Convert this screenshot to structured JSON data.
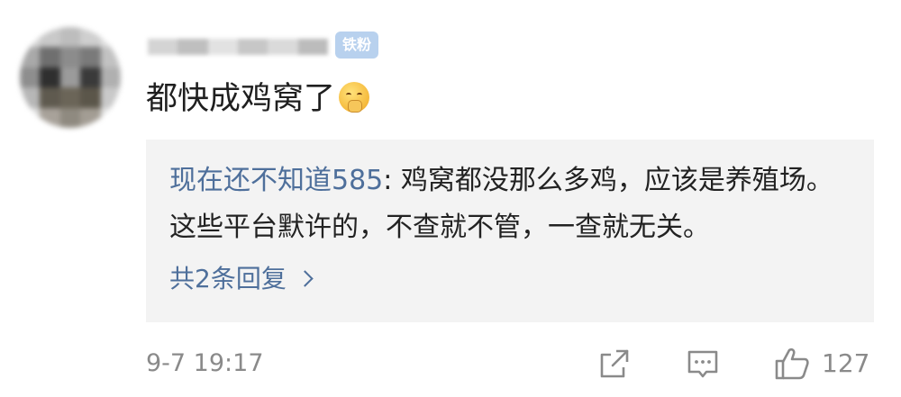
{
  "comment": {
    "badge": "铁粉",
    "text": "都快成鸡窝了",
    "emoji_icon": "shushing-face-emoji"
  },
  "reply": {
    "author": "现在还不知道585",
    "separator": ": ",
    "text": "鸡窝都没那么多鸡，应该是养殖场。这些平台默许的，不查就不管，一查就无关。",
    "count_label": "共2条回复"
  },
  "footer": {
    "timestamp": "9-7 19:17",
    "share_icon": "share-icon",
    "comment_icon": "comment-icon",
    "like_icon": "thumbs-up-icon",
    "like_count": "127"
  },
  "colors": {
    "link_blue": "#4e6f9b",
    "badge_bg": "#b8d1ee",
    "reply_bg": "#f3f3f3",
    "meta_gray": "#8a8a8a"
  }
}
